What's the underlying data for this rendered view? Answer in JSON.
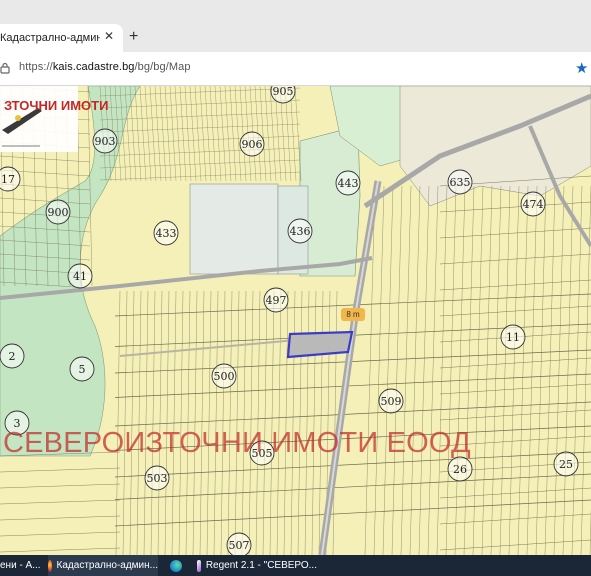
{
  "browser": {
    "tab_title": "Кадастрално-административн...",
    "tab_close": "✕",
    "new_tab": "+",
    "url_prefix": "https://",
    "url_host": "kais.cadastre.bg",
    "url_path": "/bg/bg/Map",
    "bookmark_icon": "star-icon"
  },
  "map": {
    "logo_text": "ЗТОЧНИ ИМОТИ",
    "watermark": "СЕВЕРОИЗТОЧНИ ИМОТИ ЕООД",
    "scale_badge": "8 m",
    "parcel_numbers": [
      "905",
      "903",
      "906",
      "17",
      "443",
      "635",
      "474",
      "900",
      "433",
      "436",
      "41",
      "497",
      "11",
      "2",
      "500",
      "5",
      "509",
      "3",
      "505",
      "26",
      "25",
      "503",
      "507"
    ],
    "colors": {
      "land": "#f4f0b7",
      "parcel_line": "#6f6a4f",
      "road": "#a9a9a9",
      "forest": "#bfe3bf",
      "green_zone": "#d7ecd2",
      "selected_parcel": "#4040c8"
    }
  },
  "taskbar": {
    "items": [
      {
        "label": "ени - А...",
        "icon": "browser-icon"
      },
      {
        "label": "Кадастрално-админ...",
        "icon": "firefox-icon"
      },
      {
        "label": "",
        "icon": "edge-icon"
      },
      {
        "label": "Regent 2.1 - \"СЕВЕРО...",
        "icon": "regent-app-icon"
      }
    ]
  }
}
